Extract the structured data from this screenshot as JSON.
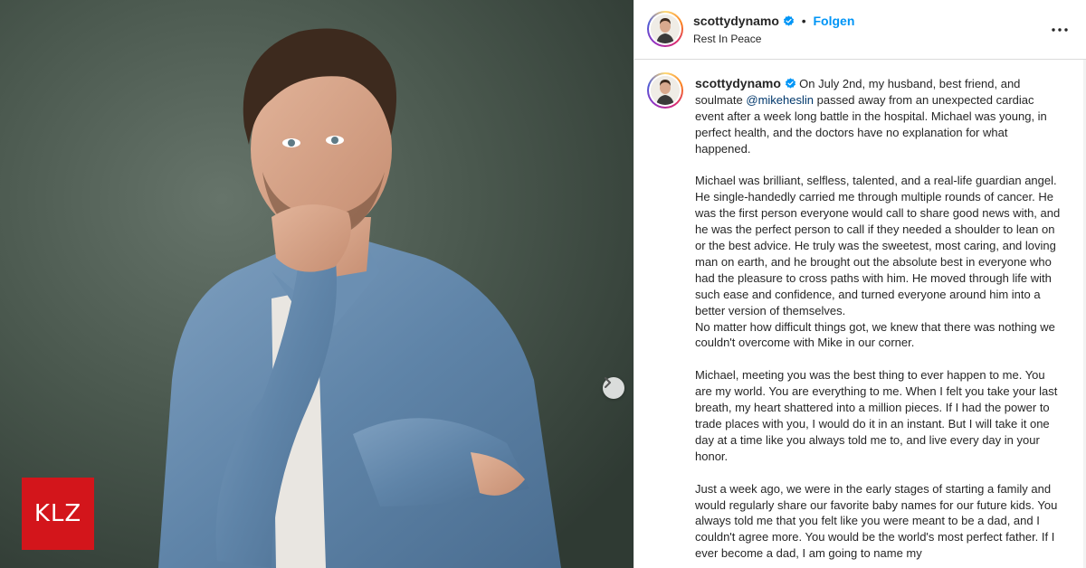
{
  "post": {
    "username": "scottydynamo",
    "dot": "•",
    "follow_label": "Folgen",
    "location": "Rest In Peace",
    "more_icon": "more-horizontal-icon",
    "next_icon": "chevron-right-icon",
    "verified_color": "#0095f6"
  },
  "watermark": {
    "text": "KLZ",
    "color": "#d3151b"
  },
  "caption": {
    "username": "scottydynamo",
    "p1_pre": " On July 2nd, my husband, best friend, and soulmate ",
    "mention": "@mikeheslin",
    "p1_post": " passed away from an unexpected cardiac event after a week long battle in the hospital. Michael was young, in perfect health, and the doctors have no explanation for what happened.",
    "p2": "Michael was brilliant, selfless, talented, and a real-life guardian angel. He single-handedly carried me through multiple rounds of cancer. He was the first person everyone would call to share good news with, and he was the perfect person to call if they needed a shoulder to lean on or the best advice. He truly was the sweetest, most caring, and loving man on earth, and he brought out the absolute best in everyone who had the pleasure to cross paths with him. He moved through life with such ease and confidence, and turned everyone around him into a better version of themselves.",
    "p3": "No matter how difficult things got, we knew that there was nothing we couldn't overcome with Mike in our corner.",
    "p4": "Michael, meeting you was the best thing to ever happen to me. You are my world. You are everything to me. When I felt you take your last breath, my heart shattered into a million pieces. If I had the power to trade places with you, I would do it in an instant. But I will take it one day at a time like you always told me to, and live every day in your honor.",
    "p5": "Just a week ago, we were in the early stages of starting a family and would regularly share our favorite baby names for our future kids. You always told me that you felt like you were meant to be a dad, and I couldn't agree more. You would be the world's most perfect father. If I ever become a dad, I am going to name my"
  }
}
